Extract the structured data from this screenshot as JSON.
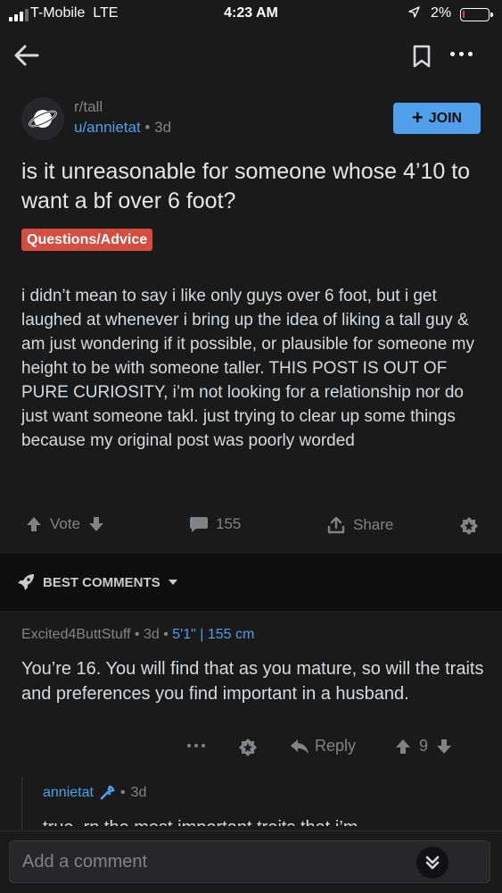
{
  "status_bar": {
    "carrier": "T-Mobile",
    "network": "LTE",
    "time": "4:23 AM",
    "battery_percent": "2%",
    "battery_level": 0.02
  },
  "post": {
    "subreddit": "r/tall",
    "author": "u/annietat",
    "age": "3d",
    "join_label": "JOIN",
    "title": "is it unreasonable for someone whose 4’10 to want a bf over 6 foot?",
    "flair": "Questions/Advice",
    "body": "i didn’t mean to say i like only guys over 6 foot, but i get laughed at whenever i bring up the idea of liking a tall guy & am just wondering if it possible, or plausible for someone my height to be with someone  taller. THIS POST IS OUT OF PURE CURIOSITY, i’m not looking for a relationship nor do just want someone takl. just trying to clear up some things because my original post was poorly worded",
    "vote_label": "Vote",
    "comment_count": "155",
    "share_label": "Share"
  },
  "sort": {
    "label": "BEST COMMENTS"
  },
  "comments": [
    {
      "author": "Excited4ButtStuff",
      "age": "3d",
      "flair": "5'1\" | 155 cm",
      "body": "You’re 16. You will find that as you mature, so will the traits and preferences you find important in a husband.",
      "reply_label": "Reply",
      "score": "9"
    }
  ],
  "reply": {
    "author": "annietat",
    "age": "3d",
    "body_preview": "true, rn the most important traits that i’m"
  },
  "composer": {
    "placeholder": "Add a comment"
  },
  "colors": {
    "background": "#1a1a1b",
    "accent": "#4f9fea",
    "flair": "#d44d3f"
  }
}
